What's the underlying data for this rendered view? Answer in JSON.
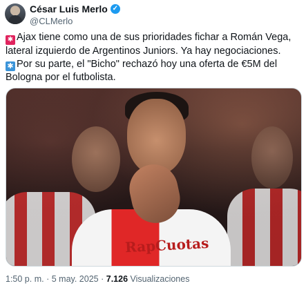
{
  "author": {
    "name": "César Luis Merlo",
    "handle": "@CLMerlo",
    "verified": true,
    "verified_color": "#1d9bf0"
  },
  "tweet": {
    "line1": "Ajax tiene como una de sus prioridades fichar a Román Vega, lateral izquierdo de Argentinos Juniors. Ya hay negociaciones.",
    "line2": "Por su parte, el \"Bicho\" rechazó hoy una oferta de €5M del Bologna por el futbolista.",
    "emoji1": "red-alert-icon",
    "emoji2": "snowflake-icon"
  },
  "media": {
    "sponsor_text": "RapCuotas"
  },
  "meta": {
    "time": "1:50 p. m.",
    "sep": "·",
    "date": "5 may. 2025",
    "sep2": "·",
    "views_count": "7.126",
    "views_label": "Visualizaciones"
  }
}
